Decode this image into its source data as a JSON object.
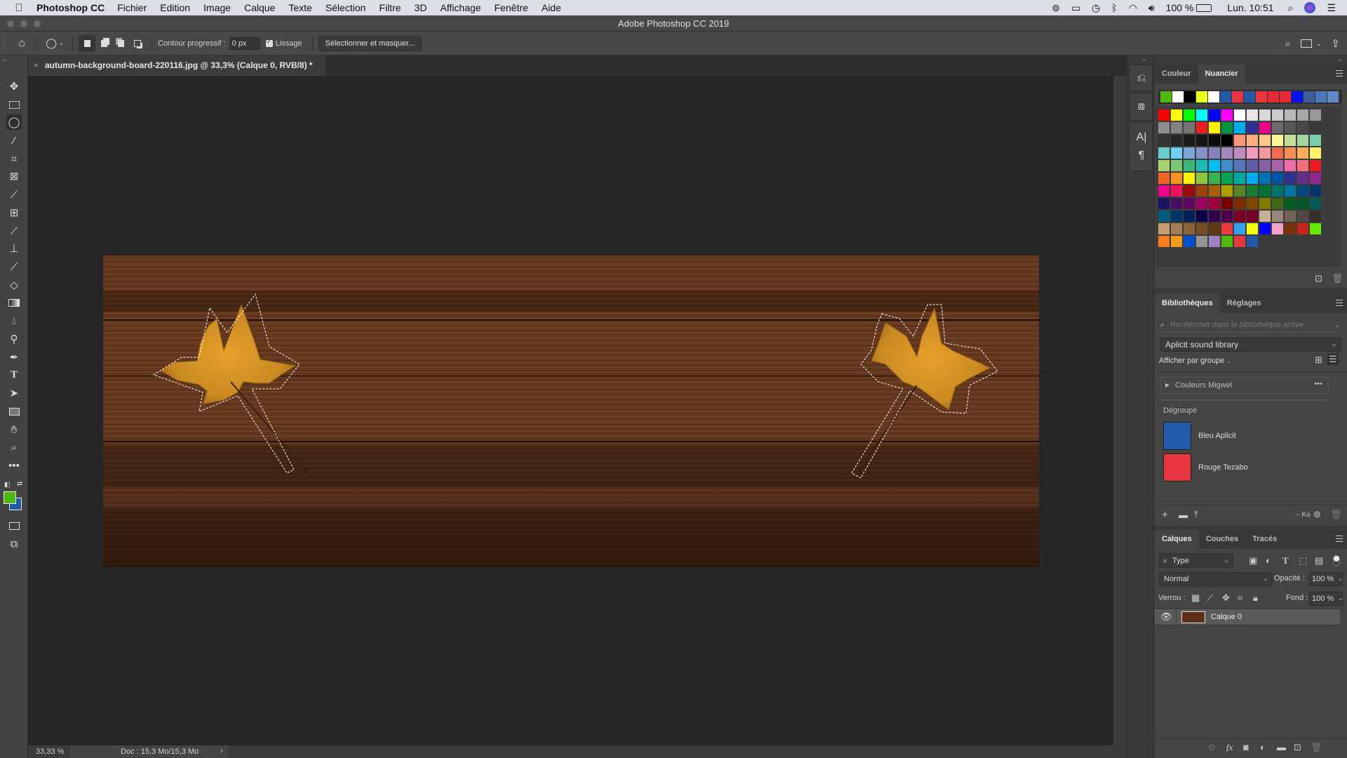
{
  "menubar": {
    "apple_icon": "apple-icon",
    "app_name": "Photoshop CC",
    "items": [
      "Fichier",
      "Edition",
      "Image",
      "Calque",
      "Texte",
      "Sélection",
      "Filtre",
      "3D",
      "Affichage",
      "Fenêtre",
      "Aide"
    ],
    "status": {
      "battery": "100 %",
      "clock": "Lun. 10:51"
    }
  },
  "window": {
    "title": "Adobe Photoshop CC 2019"
  },
  "options_bar": {
    "feather_label": "Contour progressif :",
    "feather_value": "0 px",
    "antialias_label": "Lissage",
    "antialias_checked": true,
    "select_mask_label": "Sélectionner et masquer..."
  },
  "document": {
    "tab_title": "autumn-background-board-220116.jpg @ 33,3% (Calque 0, RVB/8) *",
    "zoom": "33,33 %",
    "doc_info": "Doc : 15,3 Mo/15,3 Mo"
  },
  "toolbar": {
    "active_tool": "lasso",
    "foreground_color": "#4cb80a",
    "background_color": "#2458a8"
  },
  "swatches_panel": {
    "tabs": [
      "Couleur",
      "Nuancier"
    ],
    "active_tab": "Nuancier",
    "recent": [
      "#4cb80a",
      "#ffffff",
      "#000000",
      "#eeff1c",
      "#ffffff",
      "#2458a8",
      "#e8363e",
      "#2458a8",
      "#e8363e",
      "#e52935",
      "#e52935",
      "#0512f0",
      "#435c98",
      "#4a78bb",
      "#5e89c4"
    ],
    "grid": [
      [
        "#fe0000",
        "#ffff00",
        "#00ff00",
        "#00ffff",
        "#0000ff",
        "#ff00ff",
        "#ffffff",
        "#e5e5e5",
        "#d8d8d8",
        "#cbcbcb",
        "#b8b8b8",
        "#a8a8a8",
        "#999999"
      ],
      [
        "#8f8f8f",
        "#838383",
        "#757575",
        "#ee1c24",
        "#fff200",
        "#009444",
        "#00adef",
        "#2d3093",
        "#ec008c",
        "#6a6a6a",
        "#575757",
        "#484848",
        "#393939"
      ],
      [
        "#333333",
        "#262626",
        "#1c1c1c",
        "#141414",
        "#0c0c0c",
        "#000000",
        "#f7977a",
        "#fbad82",
        "#fdc68c",
        "#fff79a",
        "#c4df9b",
        "#a2d49f",
        "#7accac"
      ],
      [
        "#6bcdc8",
        "#6ccff6",
        "#7ba7d7",
        "#8393ca",
        "#8781bd",
        "#a287bd",
        "#bc8dbf",
        "#f49ac1",
        "#f5989d",
        "#f26d50",
        "#f68e55",
        "#fbaf5c",
        "#fff467"
      ],
      [
        "#acd372",
        "#7cc576",
        "#3bb779",
        "#1cbbb4",
        "#00bff3",
        "#438ccb",
        "#5574b9",
        "#605ca9",
        "#8560a8",
        "#a763a9",
        "#f06ea9",
        "#f26d7d",
        "#ed1c24"
      ],
      [
        "#f26522",
        "#f7941d",
        "#fff200",
        "#8dc63f",
        "#39b54a",
        "#00a651",
        "#00a99d",
        "#00aeef",
        "#0072bc",
        "#0054a5",
        "#2e3192",
        "#662d91",
        "#92278f"
      ],
      [
        "#ec008c",
        "#ed145b",
        "#9e0b0f",
        "#a0410d",
        "#a3620a",
        "#aba000",
        "#598527",
        "#197b30",
        "#007236",
        "#00746b",
        "#0076a3",
        "#004a80",
        "#003471"
      ],
      [
        "#1b1464",
        "#440e62",
        "#630460",
        "#9e005d",
        "#9e0039",
        "#790000",
        "#7b2e00",
        "#7d4900",
        "#827b00",
        "#406618",
        "#005e20",
        "#005826",
        "#005952"
      ],
      [
        "#005b7f",
        "#003663",
        "#002157",
        "#0d004c",
        "#32004b",
        "#4b0049",
        "#7a0026",
        "#7a0021",
        "#c7b299",
        "#998675",
        "#736357",
        "#534741",
        "#37302d"
      ],
      [
        "#c69c6d",
        "#a67c52",
        "#8c6239",
        "#754c24",
        "#603913",
        "#ed3b3b",
        "#34a2f0",
        "#f4fc0c",
        "#0000ff",
        "#f7a0c8",
        "#7a3206",
        "#c9231d",
        "#66e800"
      ],
      [
        "#f57e20",
        "#f49a1e",
        "#0052cc",
        "#959595",
        "#a082c4",
        "#4cb80a",
        "#e8363e",
        "#2458a8"
      ]
    ]
  },
  "libraries_panel": {
    "tabs": [
      "Bibliothèques",
      "Réglages"
    ],
    "active_tab": "Bibliothèques",
    "search_placeholder": "Rechercher dans la bibliothèque active",
    "library_select": "Aplicit sound library",
    "view_mode": "Afficher par groupe",
    "group_name": "Couleurs Migwel",
    "ungrouped_label": "Dégroupé",
    "colors": [
      {
        "name": "Bleu Aplicit",
        "hex": "#2458a8"
      },
      {
        "name": "Rouge Tezabo",
        "hex": "#e8363e"
      }
    ],
    "storage": "-- Ko"
  },
  "layers_panel": {
    "tabs": [
      "Calques",
      "Couches",
      "Tracés"
    ],
    "active_tab": "Calques",
    "filter_kind": "Type",
    "blend_mode": "Normal",
    "opacity_label": "Opacité :",
    "opacity_value": "100 %",
    "lock_label": "Verrou :",
    "fill_label": "Fond :",
    "fill_value": "100 %",
    "layers": [
      {
        "name": "Calque 0",
        "visible": true,
        "selected": true
      }
    ]
  }
}
